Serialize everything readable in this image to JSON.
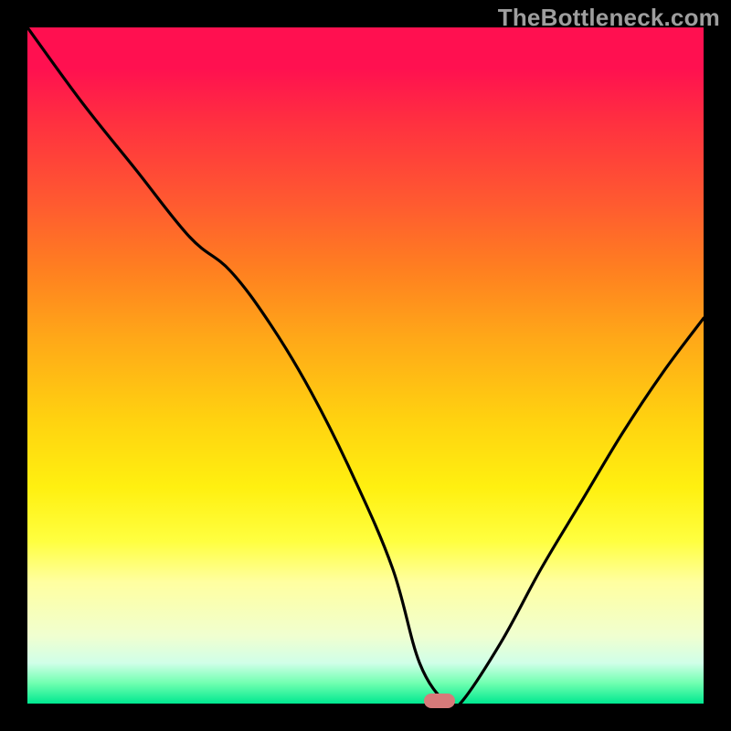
{
  "watermark": "TheBottleneck.com",
  "chart_data": {
    "type": "line",
    "title": "",
    "xlabel": "",
    "ylabel": "",
    "xlim": [
      0,
      100
    ],
    "ylim": [
      0,
      100
    ],
    "grid": false,
    "marker": {
      "x": 61,
      "y": 0
    },
    "series": [
      {
        "name": "curve",
        "x": [
          0,
          8,
          16,
          24,
          30,
          36,
          42,
          48,
          54,
          58,
          62,
          64,
          70,
          76,
          82,
          88,
          94,
          100
        ],
        "values": [
          100,
          89,
          79,
          69,
          64,
          56,
          46,
          34,
          20,
          6,
          0,
          0,
          9,
          20,
          30,
          40,
          49,
          57
        ]
      }
    ]
  },
  "colors": {
    "background": "#000000",
    "marker": "#d77a7a",
    "watermark": "#9e9e9e",
    "gradient_top": "#ff1050",
    "gradient_bottom": "#00e890"
  }
}
